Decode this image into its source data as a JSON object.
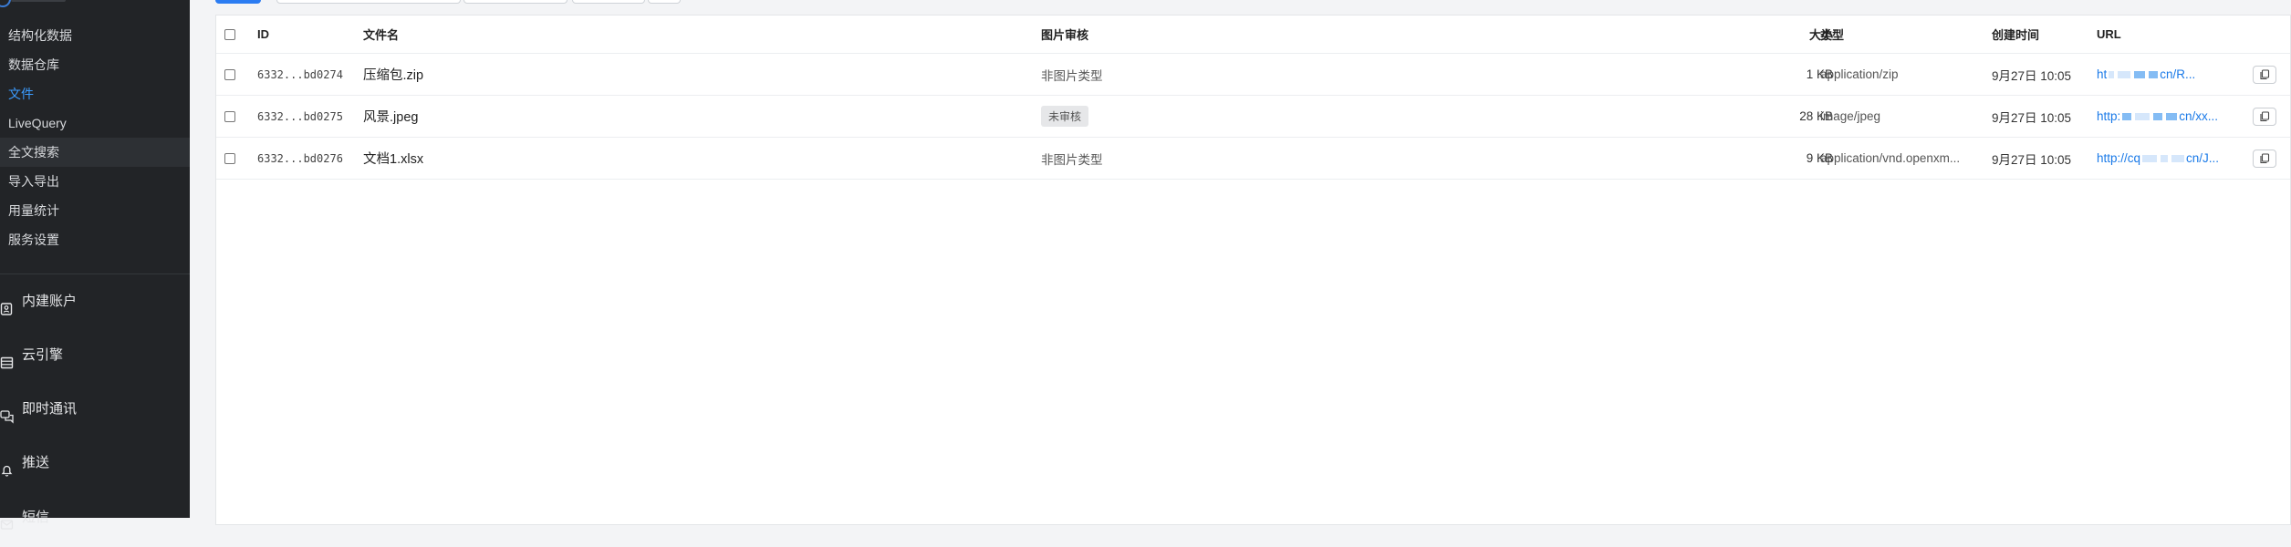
{
  "sidebar": {
    "sub_items": [
      {
        "label": "结构化数据"
      },
      {
        "label": "数据仓库"
      },
      {
        "label": "文件"
      },
      {
        "label": "LiveQuery"
      },
      {
        "label": "全文搜索"
      },
      {
        "label": "导入导出"
      },
      {
        "label": "用量统计"
      },
      {
        "label": "服务设置"
      }
    ],
    "main_items": [
      {
        "label": "内建账户",
        "icon": "contact-card-icon"
      },
      {
        "label": "云引擎",
        "icon": "server-icon"
      },
      {
        "label": "即时通讯",
        "icon": "chat-icon"
      },
      {
        "label": "推送",
        "icon": "bell-icon"
      },
      {
        "label": "短信",
        "icon": "message-icon"
      }
    ],
    "active_item": "文件",
    "accent_color": "#3b9cff"
  },
  "table": {
    "headers": {
      "id": "ID",
      "name": "文件名",
      "audit": "图片审核",
      "size": "大小",
      "type": "类型",
      "created": "创建时间",
      "url": "URL"
    },
    "rows": [
      {
        "id": "6332...bd0274",
        "name": "压缩包.zip",
        "audit": "非图片类型",
        "size": "1 KB",
        "type": "application/zip",
        "created": "9月27日 10:05",
        "url_start": "ht",
        "url_end": "cn/R..."
      },
      {
        "id": "6332...bd0275",
        "name": "风景.jpeg",
        "audit": "未审核",
        "size": "28 KB",
        "type": "image/jpeg",
        "created": "9月27日 10:05",
        "url_start": "http:",
        "url_end": "cn/xx..."
      },
      {
        "id": "6332...bd0276",
        "name": "文档1.xlsx",
        "audit": "非图片类型",
        "size": "9 KB",
        "type": "application/vnd.openxm...",
        "created": "9月27日 10:05",
        "url_start": "http://cq",
        "url_end": "cn/J..."
      }
    ]
  },
  "colors": {
    "sidebar_bg": "#222427",
    "link": "#1a7ae8",
    "primary": "#2b7cf2"
  }
}
